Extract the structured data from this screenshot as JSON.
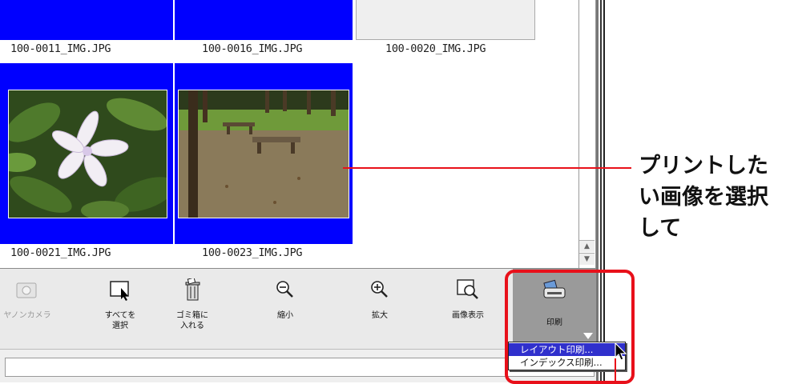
{
  "thumbnails": {
    "row1": [
      {
        "filename": "100-0011_IMG.JPG",
        "selected": true
      },
      {
        "filename": "100-0016_IMG.JPG",
        "selected": true
      },
      {
        "filename": "100-0020_IMG.JPG",
        "selected": false
      }
    ],
    "row2": [
      {
        "filename": "100-0021_IMG.JPG",
        "selected": true
      },
      {
        "filename": "100-0023_IMG.JPG",
        "selected": true
      }
    ]
  },
  "toolbar": {
    "camera_label": "ヤノンカメラ",
    "select_all_label": "すべてを\n選択",
    "trash_label": "ゴミ箱に\n入れる",
    "zoom_out_label": "縮小",
    "zoom_in_label": "拡大",
    "view_image_label": "画像表示",
    "print_label": "印刷"
  },
  "print_menu": {
    "items": [
      {
        "label": "レイアウト印刷...",
        "highlighted": true
      },
      {
        "label": "インデックス印刷...",
        "highlighted": false
      }
    ]
  },
  "callout": {
    "text": "プリントしたい画像を選択して"
  },
  "colors": {
    "selection": "#0000ff",
    "annotation": "#e8101a",
    "menu_highlight": "#3030cc"
  }
}
